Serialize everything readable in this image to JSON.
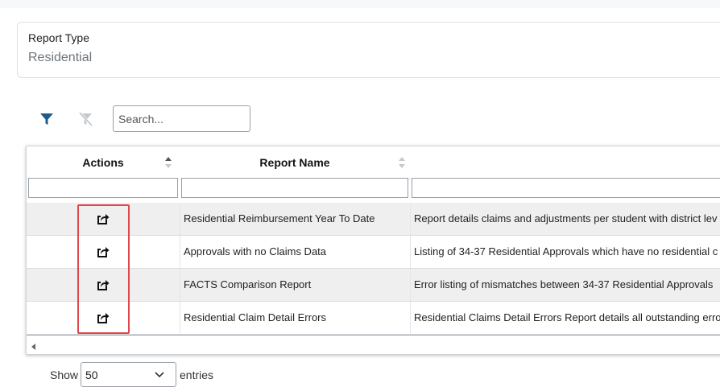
{
  "report_type": {
    "label": "Report Type",
    "value": "Residential"
  },
  "toolbar": {
    "filter_icon": "funnel-icon",
    "clear_filter_icon": "funnel-clear-icon",
    "search_placeholder": "Search..."
  },
  "table": {
    "columns": [
      "Actions",
      "Report Name",
      ""
    ],
    "rows": [
      {
        "name": "Residential Reimbursement Year To Date",
        "description": "Report details claims and adjustments per student with district lev"
      },
      {
        "name": "Approvals with no Claims Data",
        "description": "Listing of 34-37 Residential Approvals which have no residential c"
      },
      {
        "name": "FACTS Comparison Report",
        "description": "Error listing of mismatches between 34-37 Residential Approvals"
      },
      {
        "name": "Residential Claim Detail Errors",
        "description": "Residential Claims Detail Errors Report details all outstanding erro"
      }
    ],
    "action_icon": "export-icon"
  },
  "pagination": {
    "show_label": "Show",
    "page_size": "50",
    "entries_label": "entries"
  },
  "colors": {
    "filter_icon": "#1d5c8a",
    "clear_filter_icon": "#b9bec4",
    "highlight": "#e0474c",
    "row_alt": "#efefef"
  }
}
